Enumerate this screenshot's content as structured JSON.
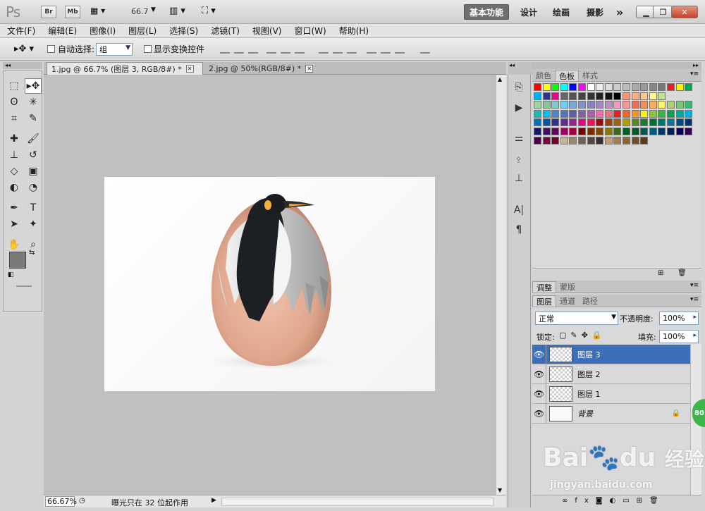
{
  "app": {
    "logo": "Ps",
    "bridge": "Br",
    "minibridge": "Mb",
    "zoom": "66.7"
  },
  "workspaces": [
    "基本功能",
    "设计",
    "绘画",
    "摄影",
    "»"
  ],
  "menu": [
    "文件(F)",
    "编辑(E)",
    "图像(I)",
    "图层(L)",
    "选择(S)",
    "滤镜(T)",
    "视图(V)",
    "窗口(W)",
    "帮助(H)"
  ],
  "options": {
    "auto_select_label": "自动选择:",
    "auto_select_value": "组",
    "show_transform_label": "显示变换控件"
  },
  "tabs": [
    {
      "title": "1.jpg @ 66.7% (图层 3, RGB/8#) *"
    },
    {
      "title": "2.jpg @ 50%(RGB/8#) *"
    }
  ],
  "status": {
    "zoom": "66.67%",
    "message": "曝光只在 32 位起作用"
  },
  "swatch_panel": {
    "tabs": [
      "颜色",
      "色板",
      "样式"
    ]
  },
  "adjust_panel": {
    "tabs": [
      "调整",
      "蒙版"
    ]
  },
  "layers_panel": {
    "tabs": [
      "图层",
      "通道",
      "路径"
    ],
    "blend_mode": "正常",
    "opacity_label": "不透明度:",
    "opacity": "100%",
    "lock_label": "锁定:",
    "fill_label": "填充:",
    "fill": "100%",
    "layers": [
      {
        "name": "图层 3",
        "selected": true
      },
      {
        "name": "图层 2",
        "selected": false
      },
      {
        "name": "图层 1",
        "selected": false
      },
      {
        "name": "背景",
        "selected": false,
        "locked": true
      }
    ]
  },
  "watermark": {
    "brand": "Bai",
    "brand2": "du",
    "cn": "经验",
    "url": "jingyan.baidu.com"
  },
  "badge": "80",
  "colors": {
    "accent": "#3d6fb9",
    "canvas_bg": "#c0c0c0"
  }
}
